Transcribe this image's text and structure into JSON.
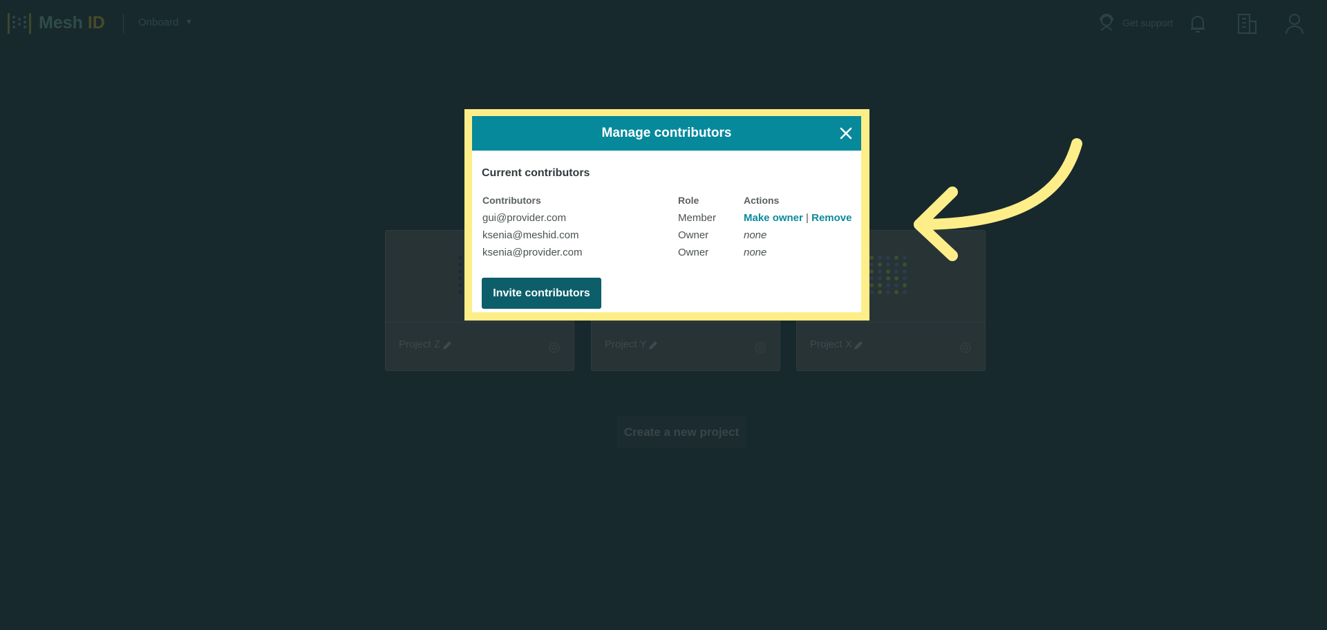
{
  "topbar": {
    "logo_main": "Mesh",
    "logo_suffix": "ID",
    "org_name": "Onboard",
    "org_caret": "▼",
    "support_label": "Get support",
    "icons": [
      "support-icon",
      "bell-icon",
      "building-icon",
      "user-icon"
    ]
  },
  "projects": [
    {
      "name": "Project Z"
    },
    {
      "name": "Project Y"
    },
    {
      "name": "Project X"
    }
  ],
  "create_project_label": "Create a new project",
  "modal": {
    "title": "Manage contributors",
    "section_title": "Current contributors",
    "columns": [
      "Contributors",
      "Role",
      "Actions"
    ],
    "rows": [
      {
        "email": "gui@provider.com",
        "role": "Member",
        "actions": [
          "Make owner",
          "|",
          "Remove"
        ]
      },
      {
        "email": "ksenia@meshid.com",
        "role": "Owner",
        "actions_text": "none"
      },
      {
        "email": "ksenia@provider.com",
        "role": "Owner",
        "actions_text": "none"
      }
    ],
    "invite_label": "Invite contributors"
  },
  "colors": {
    "background": "#18292d",
    "modal_header": "#06899b",
    "highlight_frame": "#fdee8a",
    "primary_button": "#0b5e6a",
    "link": "#0c8a9a",
    "annotation_arrow": "#fdee8a"
  }
}
